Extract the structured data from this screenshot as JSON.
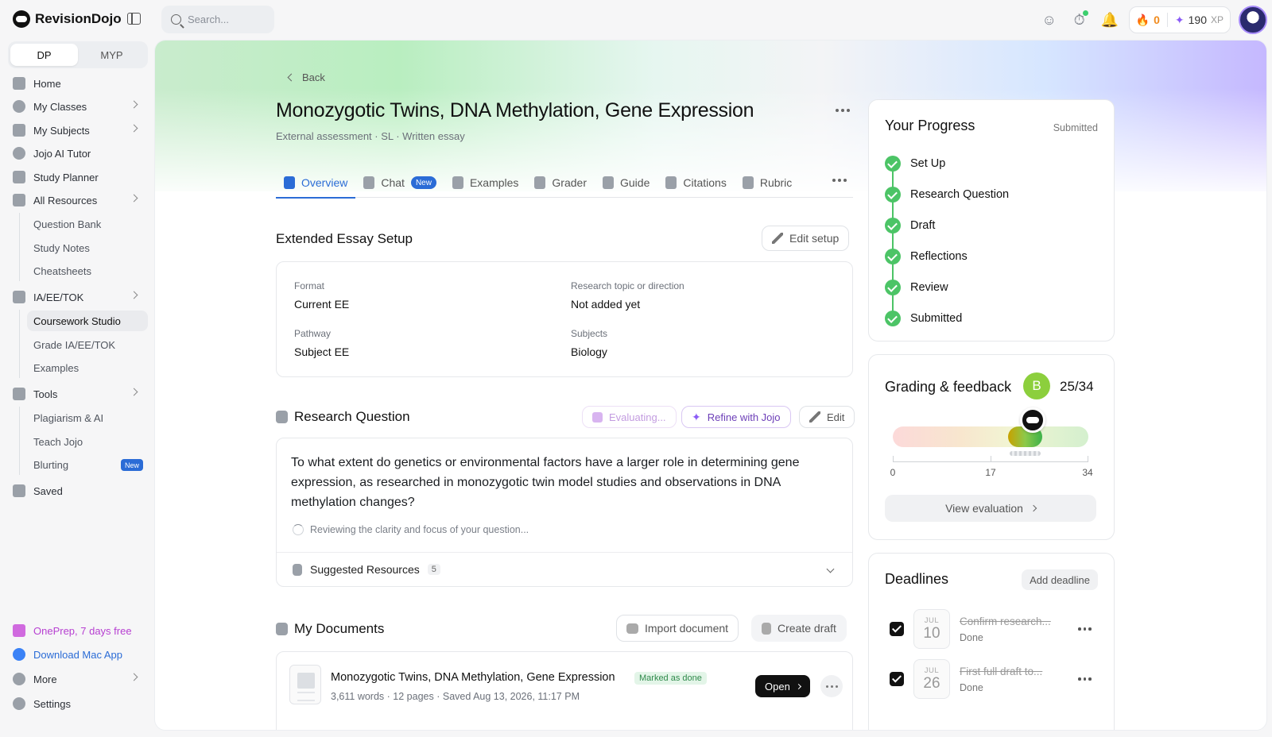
{
  "app": {
    "name": "RevisionDojo"
  },
  "search": {
    "placeholder": "Search..."
  },
  "header": {
    "streak": "0",
    "xp_value": "190",
    "xp_unit": "XP"
  },
  "sidebar": {
    "program_tabs": [
      "DP",
      "MYP"
    ],
    "items": [
      {
        "label": "Home"
      },
      {
        "label": "My Classes"
      },
      {
        "label": "My Subjects"
      },
      {
        "label": "Jojo AI Tutor"
      },
      {
        "label": "Study Planner"
      },
      {
        "label": "All Resources"
      }
    ],
    "resources_sub": [
      "Question Bank",
      "Study Notes",
      "Cheatsheets"
    ],
    "coursework": {
      "label": "IA/EE/TOK",
      "sub": [
        "Coursework Studio",
        "Grade IA/EE/TOK",
        "Examples"
      ]
    },
    "tools": {
      "label": "Tools",
      "sub": [
        "Plagiarism & AI",
        "Teach Jojo",
        "Blurting"
      ],
      "new_badge": "New"
    },
    "saved": "Saved",
    "promo": "OnePrep, 7 days free",
    "download": "Download Mac App",
    "more": "More",
    "settings": "Settings"
  },
  "page": {
    "back": "Back",
    "title": "Monozygotic Twins, DNA Methylation, Gene Expression",
    "subtitle": "External assessment · SL · Written essay",
    "tabs": [
      "Overview",
      "Chat",
      "Examples",
      "Grader",
      "Guide",
      "Citations",
      "Rubric"
    ],
    "chat_badge": "New"
  },
  "setup": {
    "title": "Extended Essay Setup",
    "edit_label": "Edit setup",
    "fields": [
      {
        "label": "Format",
        "value": "Current EE"
      },
      {
        "label": "Research topic or direction",
        "value": "Not added yet"
      },
      {
        "label": "Pathway",
        "value": "Subject EE"
      },
      {
        "label": "Subjects",
        "value": "Biology"
      }
    ]
  },
  "research_question": {
    "title": "Research Question",
    "evaluating": "Evaluating...",
    "refine": "Refine with Jojo",
    "edit": "Edit",
    "text": "To what extent do genetics or environmental factors have a larger role in determining gene expression, as researched in monozygotic twin model studies and observations in DNA methylation changes?",
    "status": "Reviewing the clarity and focus of your question...",
    "resources_label": "Suggested Resources",
    "resources_count": "5"
  },
  "documents": {
    "title": "My Documents",
    "import": "Import document",
    "create": "Create draft",
    "item": {
      "title": "Monozygotic Twins, DNA Methylation, Gene Expression",
      "badge": "Marked as done",
      "words": "3,611 words",
      "pages": "12 pages",
      "saved": "Saved Aug 13, 2026, 11:17 PM",
      "open": "Open"
    }
  },
  "progress": {
    "title": "Your Progress",
    "status": "Submitted",
    "steps": [
      "Set Up",
      "Research Question",
      "Draft",
      "Reflections",
      "Review",
      "Submitted"
    ]
  },
  "grading": {
    "title": "Grading & feedback",
    "grade": "B",
    "score": 25,
    "max": 34,
    "score_text": "25/34",
    "band_low": 20,
    "band_high": 26,
    "ticks": [
      "0",
      "17",
      "34"
    ],
    "view": "View evaluation"
  },
  "deadlines": {
    "title": "Deadlines",
    "add": "Add deadline",
    "items": [
      {
        "month": "JUL",
        "day": "10",
        "title": "Confirm research...",
        "status": "Done"
      },
      {
        "month": "JUL",
        "day": "26",
        "title": "First full draft to...",
        "status": "Done"
      }
    ]
  }
}
